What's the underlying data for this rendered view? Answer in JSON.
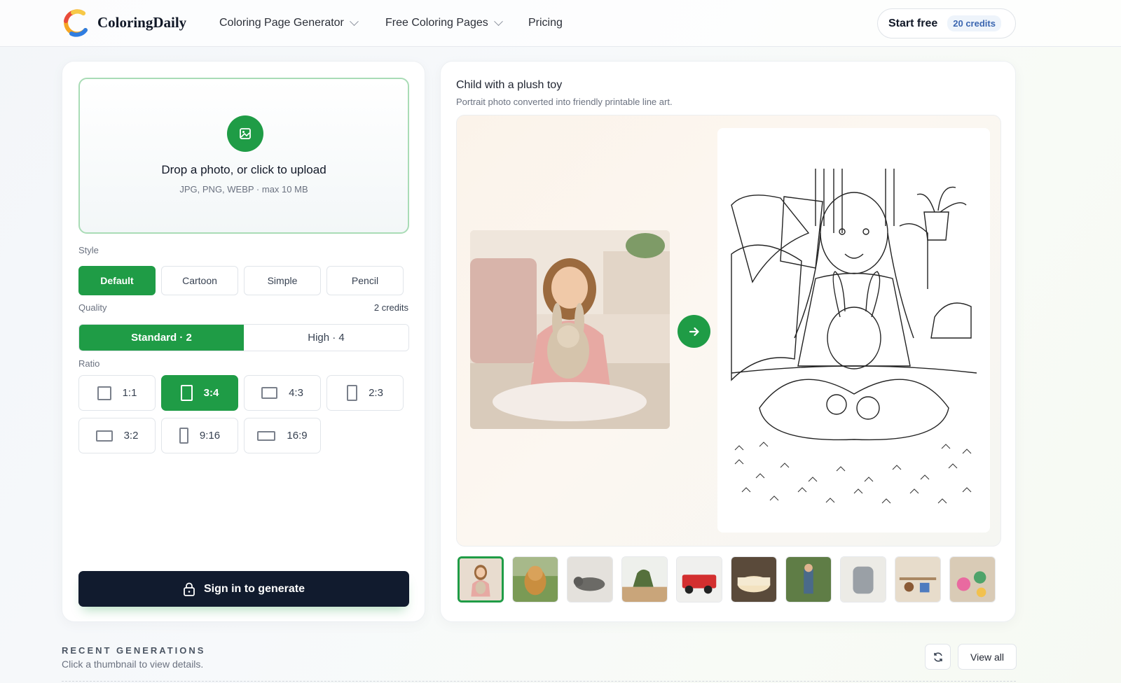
{
  "header": {
    "brand": "ColoringDaily",
    "nav": [
      {
        "label": "Coloring Page Generator",
        "has_dropdown": true
      },
      {
        "label": "Free Coloring Pages",
        "has_dropdown": true
      },
      {
        "label": "Pricing",
        "has_dropdown": false
      }
    ],
    "start_free": "Start free",
    "credits_badge": "20 credits"
  },
  "upload": {
    "title": "Drop a photo, or click to upload",
    "subtitle": "JPG, PNG, WEBP · max 10 MB",
    "icon": "image-upload-icon"
  },
  "style": {
    "label": "Style",
    "options": [
      "Default",
      "Cartoon",
      "Simple",
      "Pencil"
    ],
    "selected": "Default"
  },
  "quality": {
    "label": "Quality",
    "cost": "2 credits",
    "options": [
      "Standard · 2",
      "High · 4"
    ],
    "selected": "Standard · 2"
  },
  "ratio": {
    "label": "Ratio",
    "options": [
      "1:1",
      "3:4",
      "4:3",
      "2:3",
      "3:2",
      "9:16",
      "16:9"
    ],
    "selected": "3:4"
  },
  "generate_button": "Sign in to generate",
  "preview": {
    "title": "Child with a plush toy",
    "subtitle": "Portrait photo converted into friendly printable line art.",
    "examples": [
      "child-with-plush-toy",
      "golden-retriever",
      "cat-on-bed",
      "toy-dinosaur",
      "toy-fire-truck",
      "birthday-cake",
      "girl-in-garden",
      "backpack",
      "toy-shelf",
      "crafts"
    ],
    "selected_example": 0
  },
  "recent": {
    "title": "RECENT GENERATIONS",
    "subtitle": "Click a thumbnail to view details.",
    "view_all": "View all"
  },
  "colors": {
    "accent_green": "#1f9c46",
    "dark_button": "#111b2e",
    "credit_blue": "#3b66b0"
  }
}
